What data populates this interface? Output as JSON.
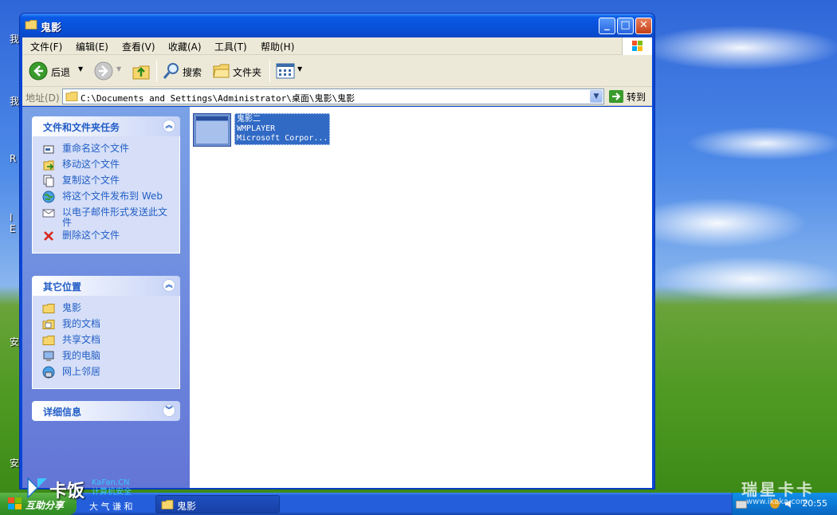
{
  "desktop": {
    "side_chars": [
      "我",
      "我",
      "R",
      "I",
      "E",
      "安",
      "安"
    ]
  },
  "window": {
    "title": "鬼影",
    "buttons": {
      "minimize": "_",
      "maximize": "□",
      "close": "✕"
    }
  },
  "menubar": {
    "items": [
      "文件(F)",
      "编辑(E)",
      "查看(V)",
      "收藏(A)",
      "工具(T)",
      "帮助(H)"
    ]
  },
  "toolbar": {
    "back_label": "后退",
    "search_label": "搜索",
    "folders_label": "文件夹"
  },
  "addressbar": {
    "label": "地址(D)",
    "path": "C:\\Documents and Settings\\Administrator\\桌面\\鬼影\\鬼影",
    "goto_label": "转到"
  },
  "taskpane": {
    "file_tasks": {
      "title": "文件和文件夹任务",
      "items": [
        {
          "label": "重命名这个文件",
          "icon": "rename-icon"
        },
        {
          "label": "移动这个文件",
          "icon": "move-icon"
        },
        {
          "label": "复制这个文件",
          "icon": "copy-icon"
        },
        {
          "label": "将这个文件发布到 Web",
          "icon": "web-publish-icon"
        },
        {
          "label": "以电子邮件形式发送此文件",
          "icon": "email-icon"
        },
        {
          "label": "删除这个文件",
          "icon": "delete-icon"
        }
      ]
    },
    "other_places": {
      "title": "其它位置",
      "items": [
        {
          "label": "鬼影",
          "icon": "folder-icon"
        },
        {
          "label": "我的文档",
          "icon": "documents-icon"
        },
        {
          "label": "共享文档",
          "icon": "shared-folder-icon"
        },
        {
          "label": "我的电脑",
          "icon": "computer-icon"
        },
        {
          "label": "网上邻居",
          "icon": "network-icon"
        }
      ]
    },
    "details": {
      "title": "详细信息"
    }
  },
  "files": [
    {
      "name": "鬼影二",
      "line2": "WMPLAYER",
      "line3": "Microsoft Corpor..."
    }
  ],
  "taskbar": {
    "start_label": "互助分享",
    "quick_label": "大 气 谦 和",
    "task_button": "鬼影",
    "clock": "20:55"
  },
  "watermark": {
    "logo_text": "卡饭",
    "site": "KaFan.CN",
    "slogan": "计算机安全",
    "right_text": "瑞星卡卡",
    "right_url": "www.ikaka.com"
  },
  "colors": {
    "titlebar": "#0a5ae6",
    "taskpane_link": "#215dc6",
    "selection": "#316ac5",
    "menubar_bg": "#ece9d8"
  }
}
